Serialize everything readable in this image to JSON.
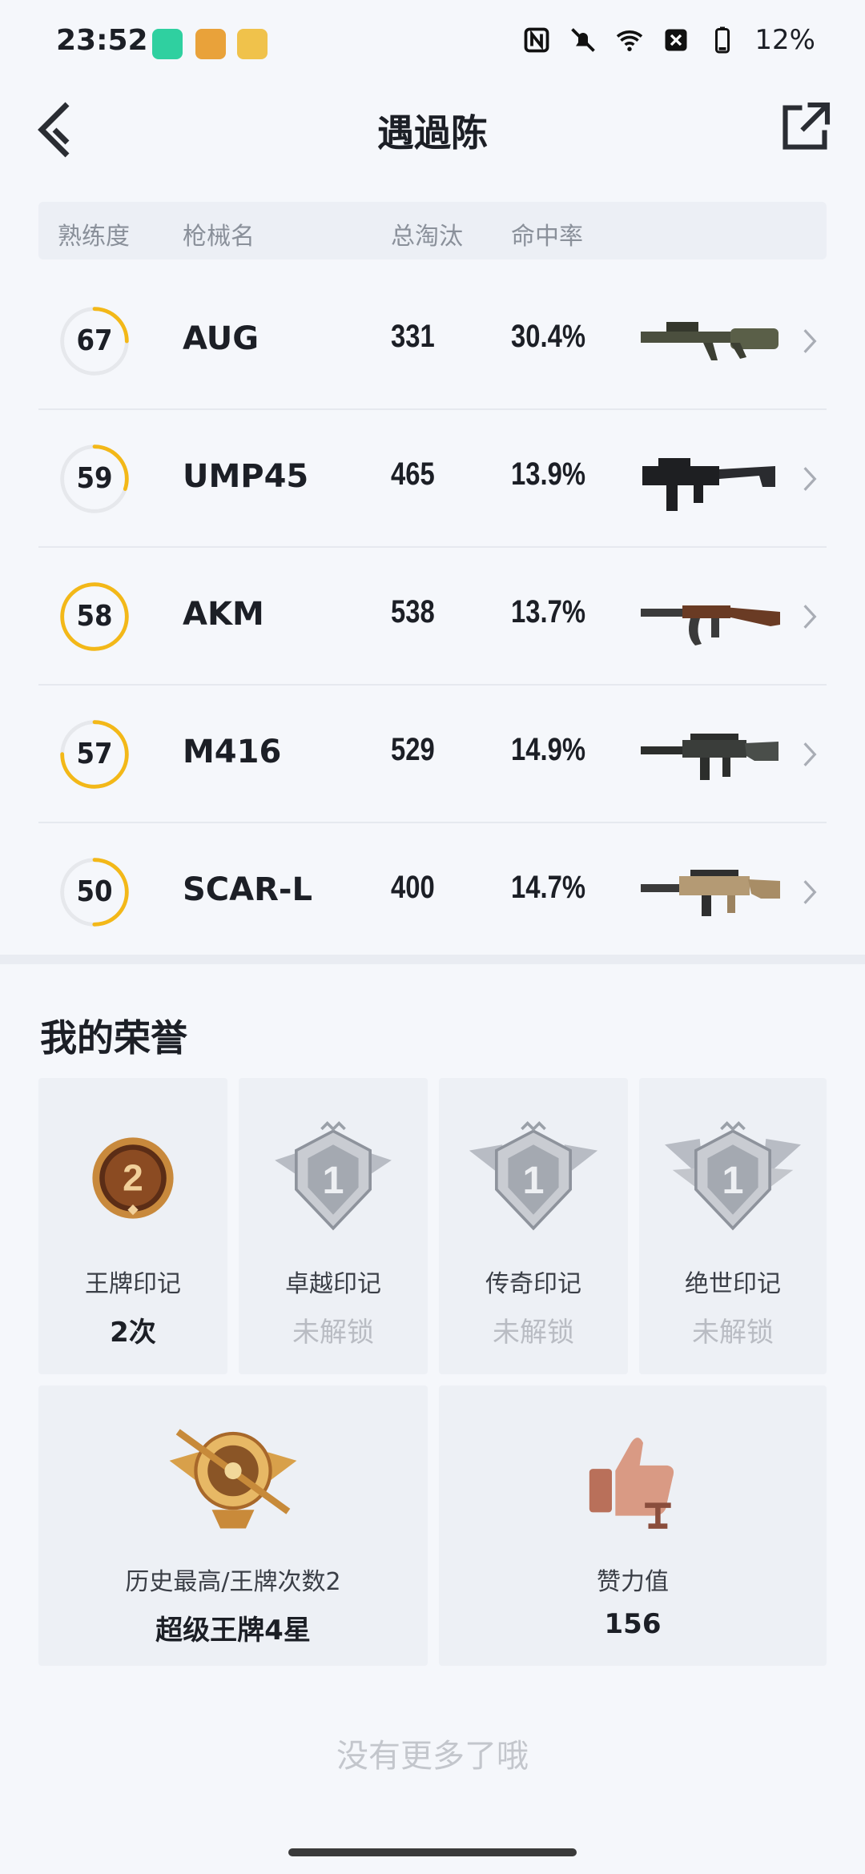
{
  "status": {
    "time": "23:52",
    "battery": "12%"
  },
  "header": {
    "title": "遇過陈"
  },
  "table": {
    "headers": [
      "熟练度",
      "枪械名",
      "总淘汰",
      "命中率"
    ],
    "rows": [
      {
        "proficiency": "67",
        "proficiency_level": 0.25,
        "name": "AUG",
        "kills": "331",
        "rate": "30.4%",
        "gun": "aug"
      },
      {
        "proficiency": "59",
        "proficiency_level": 0.3,
        "name": "UMP45",
        "kills": "465",
        "rate": "13.9%",
        "gun": "ump45"
      },
      {
        "proficiency": "58",
        "proficiency_level": 1.0,
        "name": "AKM",
        "kills": "538",
        "rate": "13.7%",
        "gun": "akm"
      },
      {
        "proficiency": "57",
        "proficiency_level": 0.75,
        "name": "M416",
        "kills": "529",
        "rate": "14.9%",
        "gun": "m416"
      },
      {
        "proficiency": "50",
        "proficiency_level": 0.5,
        "name": "SCAR-L",
        "kills": "400",
        "rate": "14.7%",
        "gun": "scar-l"
      }
    ]
  },
  "honors": {
    "title": "我的荣誉",
    "marks": [
      {
        "label": "王牌印记",
        "value": "2次",
        "badge_number": "2",
        "locked": false
      },
      {
        "label": "卓越印记",
        "value": "未解锁",
        "badge_number": "1",
        "locked": true
      },
      {
        "label": "传奇印记",
        "value": "未解锁",
        "badge_number": "1",
        "locked": true
      },
      {
        "label": "绝世印记",
        "value": "未解锁",
        "badge_number": "1",
        "locked": true
      }
    ],
    "tier": {
      "label": "历史最高/王牌次数2",
      "value": "超级王牌4星"
    },
    "likes": {
      "label": "赞力值",
      "value": "156"
    }
  },
  "footer": "没有更多了哦",
  "colors": {
    "accent": "#f3b818",
    "ring_bg": "#e6e8ec"
  }
}
